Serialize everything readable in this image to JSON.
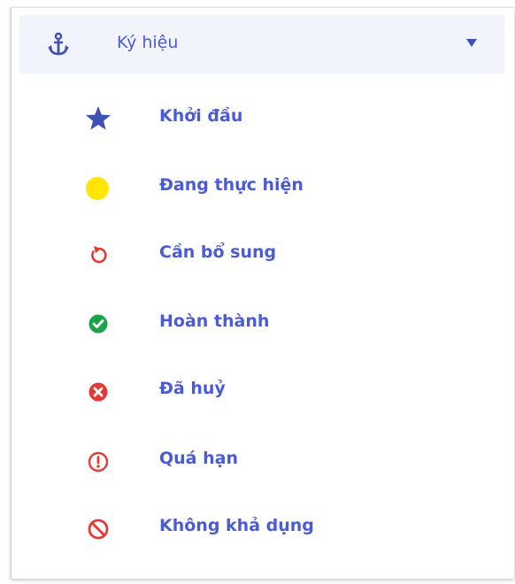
{
  "legend": {
    "title": "Ký hiệu",
    "title_icon": "anchor-icon",
    "toggle_icon": "caret-down-icon",
    "items": [
      {
        "label": "Khởi đầu",
        "icon": "star-icon",
        "color": "#3f51b5"
      },
      {
        "label": "Đang thực hiện",
        "icon": "yellow-circle-icon",
        "color": "#ffe600"
      },
      {
        "label": "Cần bổ sung",
        "icon": "undo-icon",
        "color": "#e53935"
      },
      {
        "label": "Hoàn thành",
        "icon": "check-circle-icon",
        "color": "#1aa34a"
      },
      {
        "label": "Đã huỷ",
        "icon": "times-circle-icon",
        "color": "#e53935"
      },
      {
        "label": "Quá hạn",
        "icon": "exclamation-circle-icon",
        "color": "#e53935"
      },
      {
        "label": "Không khả dụng",
        "icon": "ban-icon",
        "color": "#e53935"
      }
    ]
  },
  "colors": {
    "accent_text": "#4b5bd6",
    "header_background": "#f2f4fb",
    "caret": "#3f51b5"
  }
}
